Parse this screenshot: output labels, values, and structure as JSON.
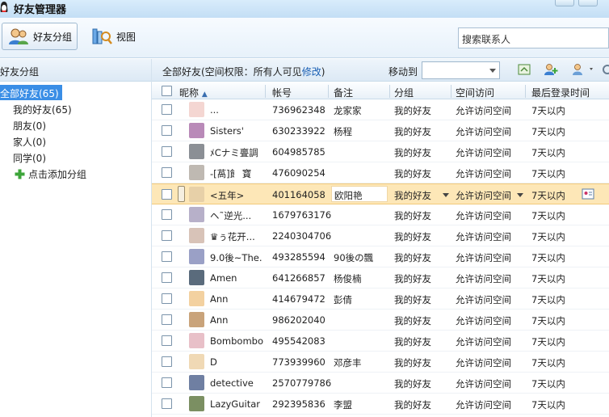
{
  "window": {
    "title": "好友管理器"
  },
  "toolbar": {
    "friend_groups_label": "好友分组",
    "view_label": "视图",
    "search_placeholder": "搜索联系人"
  },
  "sidebar": {
    "header": "好友分组",
    "groups": [
      {
        "label": "全部好友(65)",
        "selected": true
      },
      {
        "label": "我的好友(65)",
        "selected": false
      },
      {
        "label": "朋友(0)",
        "selected": false
      },
      {
        "label": "家人(0)",
        "selected": false
      },
      {
        "label": "同学(0)",
        "selected": false
      }
    ],
    "add_group_label": "点击添加分组"
  },
  "main": {
    "permission_prefix": "全部好友(空间权限：所有人可见",
    "permission_link": "修改",
    "permission_suffix": ")",
    "move_to_label": "移动到",
    "columns": {
      "nickname": "昵称",
      "account": "帐号",
      "remark": "备注",
      "group": "分组",
      "space_access": "空间访问",
      "last_login": "最后登录时间"
    },
    "rows": [
      {
        "nickname": "...",
        "account": "736962348",
        "remark": "龙家家",
        "group": "我的好友",
        "space": "允许访问空间",
        "last": "7天以内"
      },
      {
        "nickname": "Sisters'",
        "account": "630233922",
        "remark": "杨程",
        "group": "我的好友",
        "space": "允许访问空间",
        "last": "7天以内"
      },
      {
        "nickname": "ﾒCナミ亹調",
        "account": "604985785",
        "remark": "",
        "group": "我的好友",
        "space": "允许访问空间",
        "last": "7天以内"
      },
      {
        "nickname": "-[萵]飠 寶",
        "account": "476090254",
        "remark": "",
        "group": "我的好友",
        "space": "允许访问空间",
        "last": "7天以内"
      },
      {
        "nickname": "<五年>",
        "account": "401164058",
        "remark": "欧阳艳",
        "group": "我的好友",
        "space": "允许访问空间",
        "last": "7天以内"
      },
      {
        "nickname": "ヘ˜逆光...",
        "account": "1679763176",
        "remark": "",
        "group": "我的好友",
        "space": "允许访问空间",
        "last": "7天以内"
      },
      {
        "nickname": "♛ぅ花开...",
        "account": "2240304706",
        "remark": "",
        "group": "我的好友",
        "space": "允许访问空间",
        "last": "7天以内"
      },
      {
        "nickname": "9.0後~The.",
        "account": "493285594",
        "remark": "90後の飄",
        "group": "我的好友",
        "space": "允许访问空间",
        "last": "7天以内"
      },
      {
        "nickname": "Amen",
        "account": "641266857",
        "remark": "杨俊楠",
        "group": "我的好友",
        "space": "允许访问空间",
        "last": "7天以内"
      },
      {
        "nickname": "Ann",
        "account": "414679472",
        "remark": "彭倩",
        "group": "我的好友",
        "space": "允许访问空间",
        "last": "7天以内"
      },
      {
        "nickname": "Ann",
        "account": "986202040",
        "remark": "",
        "group": "我的好友",
        "space": "允许访问空间",
        "last": "7天以内"
      },
      {
        "nickname": "Bombombom",
        "account": "495542083",
        "remark": "",
        "group": "我的好友",
        "space": "允许访问空间",
        "last": "7天以内"
      },
      {
        "nickname": "D",
        "account": "773939960",
        "remark": "邓彦丰",
        "group": "我的好友",
        "space": "允许访问空间",
        "last": "7天以内"
      },
      {
        "nickname": "detective",
        "account": "2570779786",
        "remark": "",
        "group": "我的好友",
        "space": "允许访问空间",
        "last": "7天以内"
      },
      {
        "nickname": "LazyGuitar",
        "account": "292395836",
        "remark": "李盟",
        "group": "我的好友",
        "space": "允许访问空间",
        "last": "7天以内"
      }
    ]
  },
  "colors": {
    "selected_group_bg": "#3a8ee6",
    "highlight_row_bg": "#fde7b7",
    "link": "#1a5fb4"
  }
}
